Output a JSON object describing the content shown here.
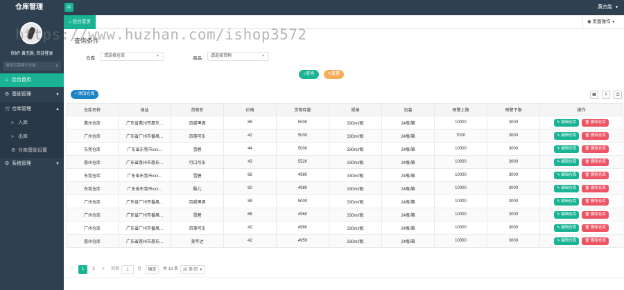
{
  "header": {
    "app_title": "仓库管理",
    "menu_icon": "hamburger-icon",
    "user_name": "黄杰胜",
    "user_caret": "▼"
  },
  "sidebar": {
    "welcome": "你好! 黄杰胜, 欢迎登录",
    "search_placeholder": "搜索您需要的功能",
    "items": [
      {
        "label": "后台首页",
        "icon": "home-icon"
      },
      {
        "label": "基础管理",
        "icon": "gear-icon"
      },
      {
        "label": "仓库管理",
        "icon": "cart-icon"
      },
      {
        "label": "入库",
        "icon": "double-chevron-icon"
      },
      {
        "label": "出库",
        "icon": "double-chevron-icon"
      },
      {
        "label": "仓库基础设置",
        "icon": "cog-icon"
      },
      {
        "label": "系统管理",
        "icon": "gear-icon"
      }
    ]
  },
  "tabs": {
    "home_label": "后台首页",
    "page_ops_label": "页面操作"
  },
  "watermark": "https://www.huzhan.com/ishop3572",
  "query": {
    "title": "查询条件",
    "warehouse_label": "仓库",
    "warehouse_placeholder": "请选择仓库",
    "goods_label": "商品",
    "goods_placeholder": "请选择货物",
    "search_button": "查询",
    "reset_button": "重置"
  },
  "toolbar": {
    "add_button": "添加仓库"
  },
  "table": {
    "columns": [
      "仓库名称",
      "地址",
      "货物名",
      "价格",
      "货物存量",
      "规格",
      "包装",
      "预警上限",
      "预警下限",
      "操作"
    ],
    "edit_label": "编辑仓库",
    "delete_label": "删除仓库",
    "rows": [
      [
        "惠州仓库",
        "广东省惠州市惠东...",
        "百威啤酒",
        "88",
        "5000",
        "330ml/瓶",
        "24瓶/箱",
        "10000",
        "3000"
      ],
      [
        "广州仓库",
        "广东省广州市番禺...",
        "百事可乐",
        "42",
        "5000",
        "330ml/瓶",
        "24瓶/箱",
        "7000",
        "3000"
      ],
      [
        "东莞仓库",
        "广东省东莞市xxx...",
        "雪碧",
        "44",
        "5000",
        "330ml/瓶",
        "24瓶/箱",
        "10000",
        "3000"
      ],
      [
        "惠州仓库",
        "广东省惠州市惠东...",
        "可口可乐",
        "43",
        "5520",
        "330ml/瓶",
        "24瓶/箱",
        "10000",
        "3000"
      ],
      [
        "东莞仓库",
        "广东省东莞市xxx...",
        "雪碧",
        "66",
        "4980",
        "330ml/瓶",
        "24瓶/箱",
        "10000",
        "3000"
      ],
      [
        "东莞仓库",
        "广东省东莞市xxx...",
        "酷儿",
        "60",
        "4980",
        "330ml/瓶",
        "24瓶/箱",
        "10000",
        "3000"
      ],
      [
        "广州仓库",
        "广东省广州市番禺...",
        "百威啤酒",
        "88",
        "5000",
        "330ml/瓶",
        "24瓶/箱",
        "10000",
        "3000"
      ],
      [
        "广州仓库",
        "广东省广州市番禺...",
        "雪碧",
        "66",
        "4960",
        "330ml/瓶",
        "24瓶/箱",
        "10000",
        "3000"
      ],
      [
        "广州仓库",
        "广东省广州市番禺...",
        "百事可乐",
        "42",
        "4980",
        "330ml/瓶",
        "24瓶/箱",
        "10000",
        "3000"
      ],
      [
        "惠州仓库",
        "广东省惠州市惠东...",
        "美年达",
        "42",
        "4959",
        "330ml/瓶",
        "24瓶/箱",
        "10000",
        "3000"
      ]
    ]
  },
  "pagination": {
    "prev": "<",
    "pages": [
      "1",
      "2"
    ],
    "next": ">",
    "goto_label": "到第",
    "goto_value": "1",
    "page_unit": "页",
    "confirm_label": "确定",
    "total_label": "共 13 条",
    "page_size": "10 条/页"
  },
  "colors": {
    "sidebar_bg": "#2f4050",
    "accent": "#1ab394",
    "warning": "#f8ac59",
    "danger": "#ed5565",
    "primary": "#1c84c6"
  }
}
